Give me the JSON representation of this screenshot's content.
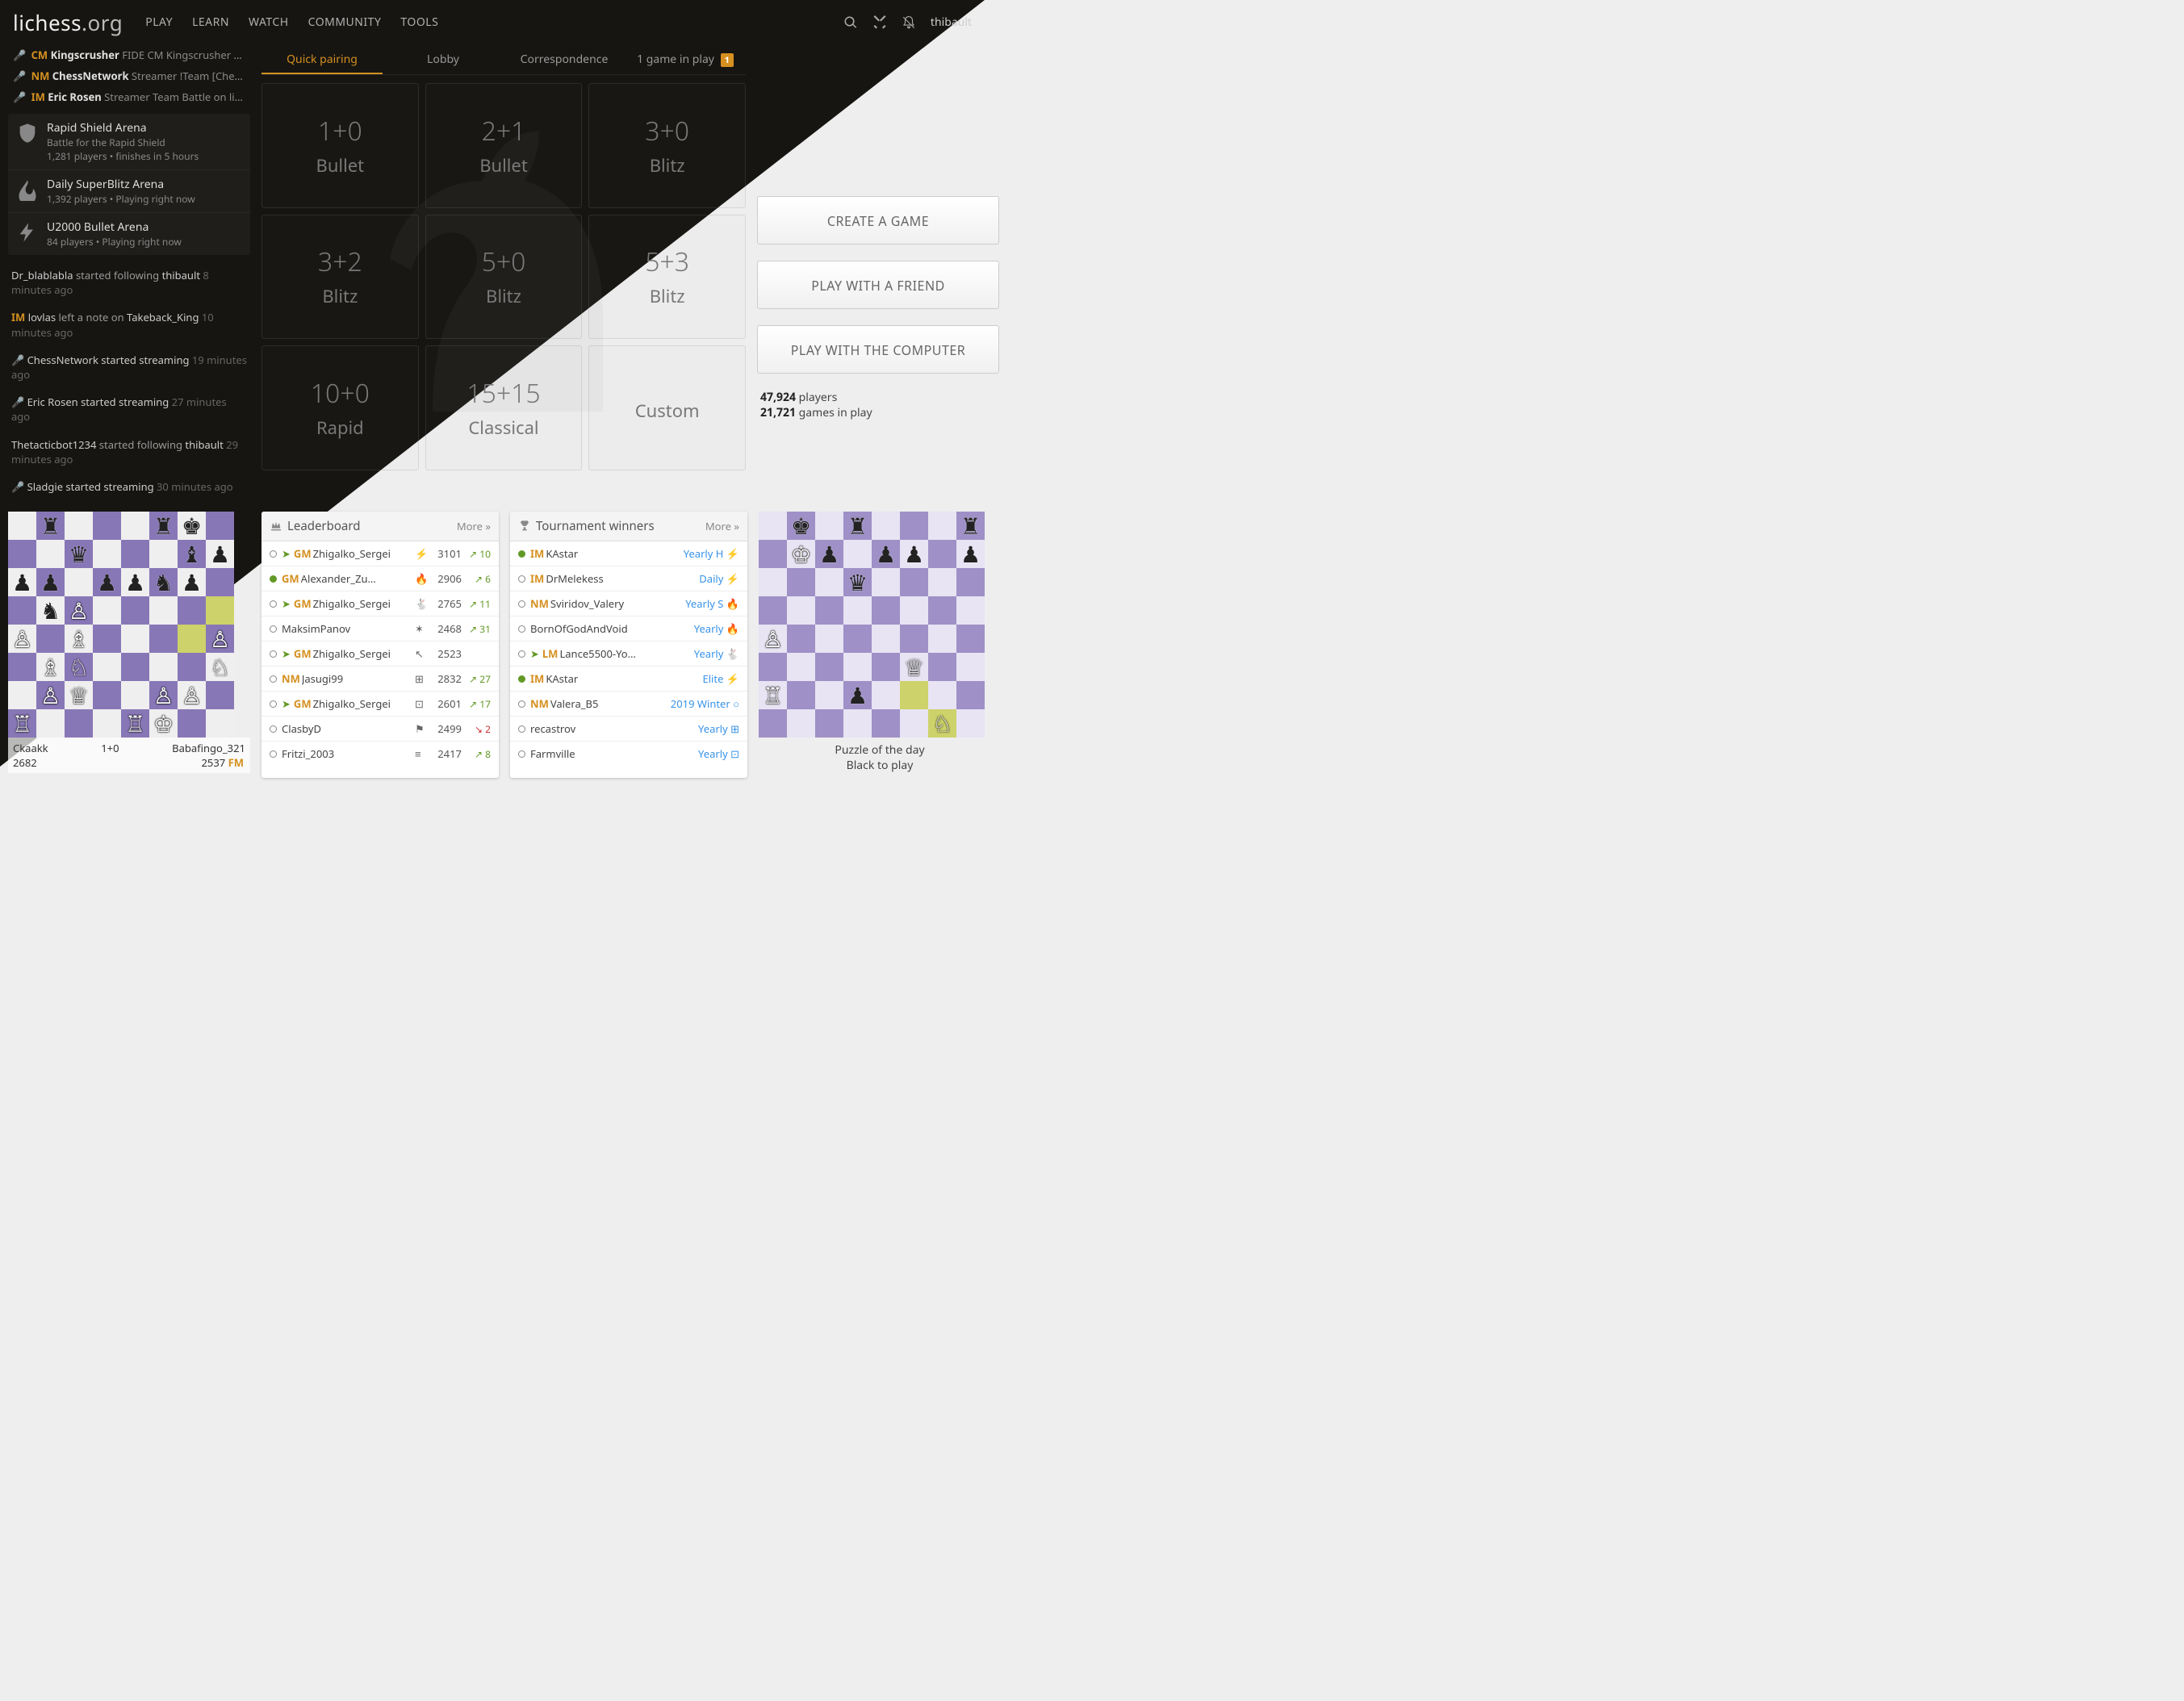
{
  "nav": {
    "brand_main": "lichess",
    "brand_ext": ".org",
    "links": [
      "PLAY",
      "LEARN",
      "WATCH",
      "COMMUNITY",
      "TOOLS"
    ],
    "user": "thibault"
  },
  "streamers": [
    {
      "title": "CM",
      "name": "Kingscrusher",
      "desc": "FIDE CM Kingscrusher pla…"
    },
    {
      "title": "NM",
      "name": "ChessNetwork",
      "desc": "Streamer !Team [Chess…"
    },
    {
      "title": "IM",
      "name": "Eric Rosen",
      "desc": "Streamer Team Battle on liche…"
    }
  ],
  "arenas": [
    {
      "icon": "shield",
      "title": "Rapid Shield Arena",
      "line1": "Battle for the Rapid Shield",
      "line2": "1,281 players • finishes  in 5 hours"
    },
    {
      "icon": "fire",
      "title": "Daily SuperBlitz Arena",
      "line1": "1,392 players • Playing right now",
      "line2": ""
    },
    {
      "icon": "bolt",
      "title": "U2000 Bullet Arena",
      "line1": "84 players • Playing right now",
      "line2": ""
    }
  ],
  "feed": [
    {
      "html": "<span class='u'>Dr_blablabla</span> started following <span class='u'>thibault</span> <span class='ago'>8 minutes ago</span>"
    },
    {
      "html": "<span class='u-im'>IM</span> <span class='u'>lovlas</span> left a note on <span class='u'>Takeback_King</span> <span class='ago'>10 minutes ago</span>"
    },
    {
      "html": "🎤 <span class='u'>ChessNetwork started streaming</span> <span class='ago'>19 minutes ago</span>"
    },
    {
      "html": "🎤 <span class='u'>Eric Rosen started streaming</span> <span class='ago'>27 minutes ago</span>"
    },
    {
      "html": "<span class='u'>Thetacticbot1234</span> started following <span class='u'>thibault</span> <span class='ago'>29 minutes ago</span>"
    },
    {
      "html": "🎤 <span class='u'>Sladgie started streaming</span> <span class='ago'>30 minutes ago</span>"
    }
  ],
  "tabs": {
    "quick": "Quick pairing",
    "lobby": "Lobby",
    "corr": "Correspondence",
    "playing_pre": "1 game in play",
    "badge": "1"
  },
  "pool": [
    {
      "tc": "1+0",
      "cat": "Bullet"
    },
    {
      "tc": "2+1",
      "cat": "Bullet"
    },
    {
      "tc": "3+0",
      "cat": "Blitz"
    },
    {
      "tc": "3+2",
      "cat": "Blitz"
    },
    {
      "tc": "5+0",
      "cat": "Blitz"
    },
    {
      "tc": "5+3",
      "cat": "Blitz"
    },
    {
      "tc": "10+0",
      "cat": "Rapid"
    },
    {
      "tc": "15+15",
      "cat": "Classical"
    },
    {
      "tc": "",
      "cat": "Custom"
    }
  ],
  "buttons": {
    "create": "CREATE A GAME",
    "friend": "PLAY WITH A FRIEND",
    "computer": "PLAY WITH THE COMPUTER"
  },
  "stats": {
    "players_n": "47,924",
    "players_l": "players",
    "games_n": "21,721",
    "games_l": "games in play"
  },
  "tv": {
    "white": "Ckaakk",
    "white_rating": "2682",
    "black": "Babafingo_321",
    "black_rating": "2537",
    "black_title": "FM",
    "clock": "1+0",
    "fen_rows": [
      ".r...rk.",
      "..q...bp",
      "pp.ppnp.",
      ".nP.....",
      "P.B....P",
      ".BN....N",
      ".PQ..PP.",
      "R...RK.."
    ],
    "hl": [
      "g4",
      "h5"
    ]
  },
  "leaderboard": {
    "title": "Leaderboard",
    "more": "More »",
    "rows": [
      {
        "online": false,
        "patron": true,
        "title": "GM",
        "name": "Zhigalko_Sergei",
        "icon": "⚡",
        "rating": "3101",
        "delta": "↗ 10",
        "dir": "up"
      },
      {
        "online": true,
        "patron": false,
        "title": "GM",
        "name": "Alexander_Zu…",
        "icon": "🔥",
        "rating": "2906",
        "delta": "↗ 6",
        "dir": "up"
      },
      {
        "online": false,
        "patron": true,
        "title": "GM",
        "name": "Zhigalko_Sergei",
        "icon": "🐇",
        "rating": "2765",
        "delta": "↗ 11",
        "dir": "up"
      },
      {
        "online": false,
        "patron": false,
        "title": "",
        "name": "MaksimPanov",
        "icon": "✶",
        "rating": "2468",
        "delta": "↗ 31",
        "dir": "up"
      },
      {
        "online": false,
        "patron": true,
        "title": "GM",
        "name": "Zhigalko_Sergei",
        "icon": "↖",
        "rating": "2523",
        "delta": "",
        "dir": ""
      },
      {
        "online": false,
        "patron": false,
        "title": "NM",
        "name": "Jasugi99",
        "icon": "⊞",
        "rating": "2832",
        "delta": "↗ 27",
        "dir": "up"
      },
      {
        "online": false,
        "patron": true,
        "title": "GM",
        "name": "Zhigalko_Sergei",
        "icon": "⊡",
        "rating": "2601",
        "delta": "↗ 17",
        "dir": "up"
      },
      {
        "online": false,
        "patron": false,
        "title": "",
        "name": "ClasbyD",
        "icon": "⚑",
        "rating": "2499",
        "delta": "↘ 2",
        "dir": "down"
      },
      {
        "online": false,
        "patron": false,
        "title": "",
        "name": "Fritzi_2003",
        "icon": "≡",
        "rating": "2417",
        "delta": "↗ 8",
        "dir": "up"
      }
    ]
  },
  "winners": {
    "title": "Tournament winners",
    "more": "More »",
    "rows": [
      {
        "online": true,
        "title": "IM",
        "name": "KAstar",
        "event": "Yearly H",
        "icon": "⚡"
      },
      {
        "online": false,
        "title": "IM",
        "name": "DrMelekess",
        "event": "Daily",
        "icon": "⚡"
      },
      {
        "online": false,
        "title": "NM",
        "name": "Sviridov_Valery",
        "event": "Yearly S",
        "icon": "🔥"
      },
      {
        "online": false,
        "title": "",
        "name": "BornOfGodAndVoid",
        "event": "Yearly",
        "icon": "🔥"
      },
      {
        "online": false,
        "title": "LM",
        "name": "Lance5500-Yo…",
        "event": "Yearly",
        "icon": "🐇",
        "patron": true
      },
      {
        "online": true,
        "title": "IM",
        "name": "KAstar",
        "event": "Elite",
        "icon": "⚡"
      },
      {
        "online": false,
        "title": "NM",
        "name": "Valera_B5",
        "event": "2019 Winter",
        "icon": "○"
      },
      {
        "online": false,
        "title": "",
        "name": "recastrov",
        "event": "Yearly",
        "icon": "⊞"
      },
      {
        "online": false,
        "title": "",
        "name": "Farmville",
        "event": "Yearly",
        "icon": "⊡"
      }
    ]
  },
  "puzzle": {
    "title": "Puzzle of the day",
    "turn": "Black to play",
    "fen_rows": [
      ".k.r...r",
      ".Kp.pp.p",
      "...q....",
      "........",
      "P.......",
      ".....Q..",
      "R..p....",
      "......N."
    ],
    "hl": [
      "g1",
      "f2"
    ]
  }
}
